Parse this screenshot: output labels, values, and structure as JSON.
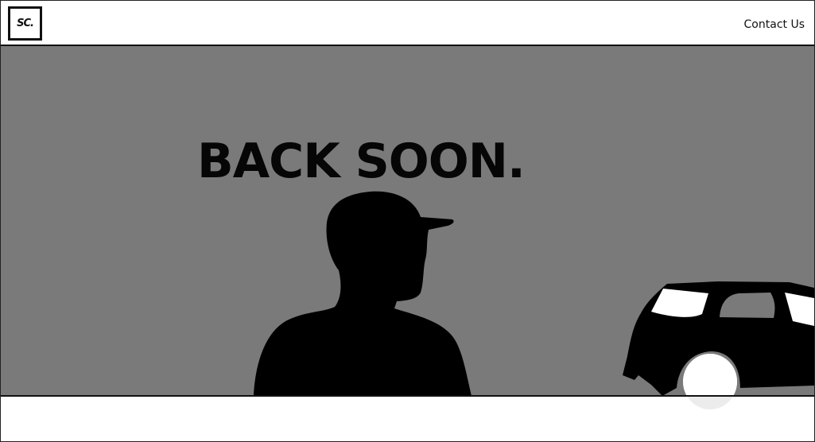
{
  "header": {
    "logo_text": "SC.",
    "nav": {
      "contact_label": "Contact Us"
    }
  },
  "hero": {
    "title": "BACK SOON.",
    "colors": {
      "background": "#7a7a7a",
      "silhouette": "#000000"
    },
    "illustrations": [
      "person-silhouette-icon",
      "car-silhouette-icon"
    ]
  }
}
